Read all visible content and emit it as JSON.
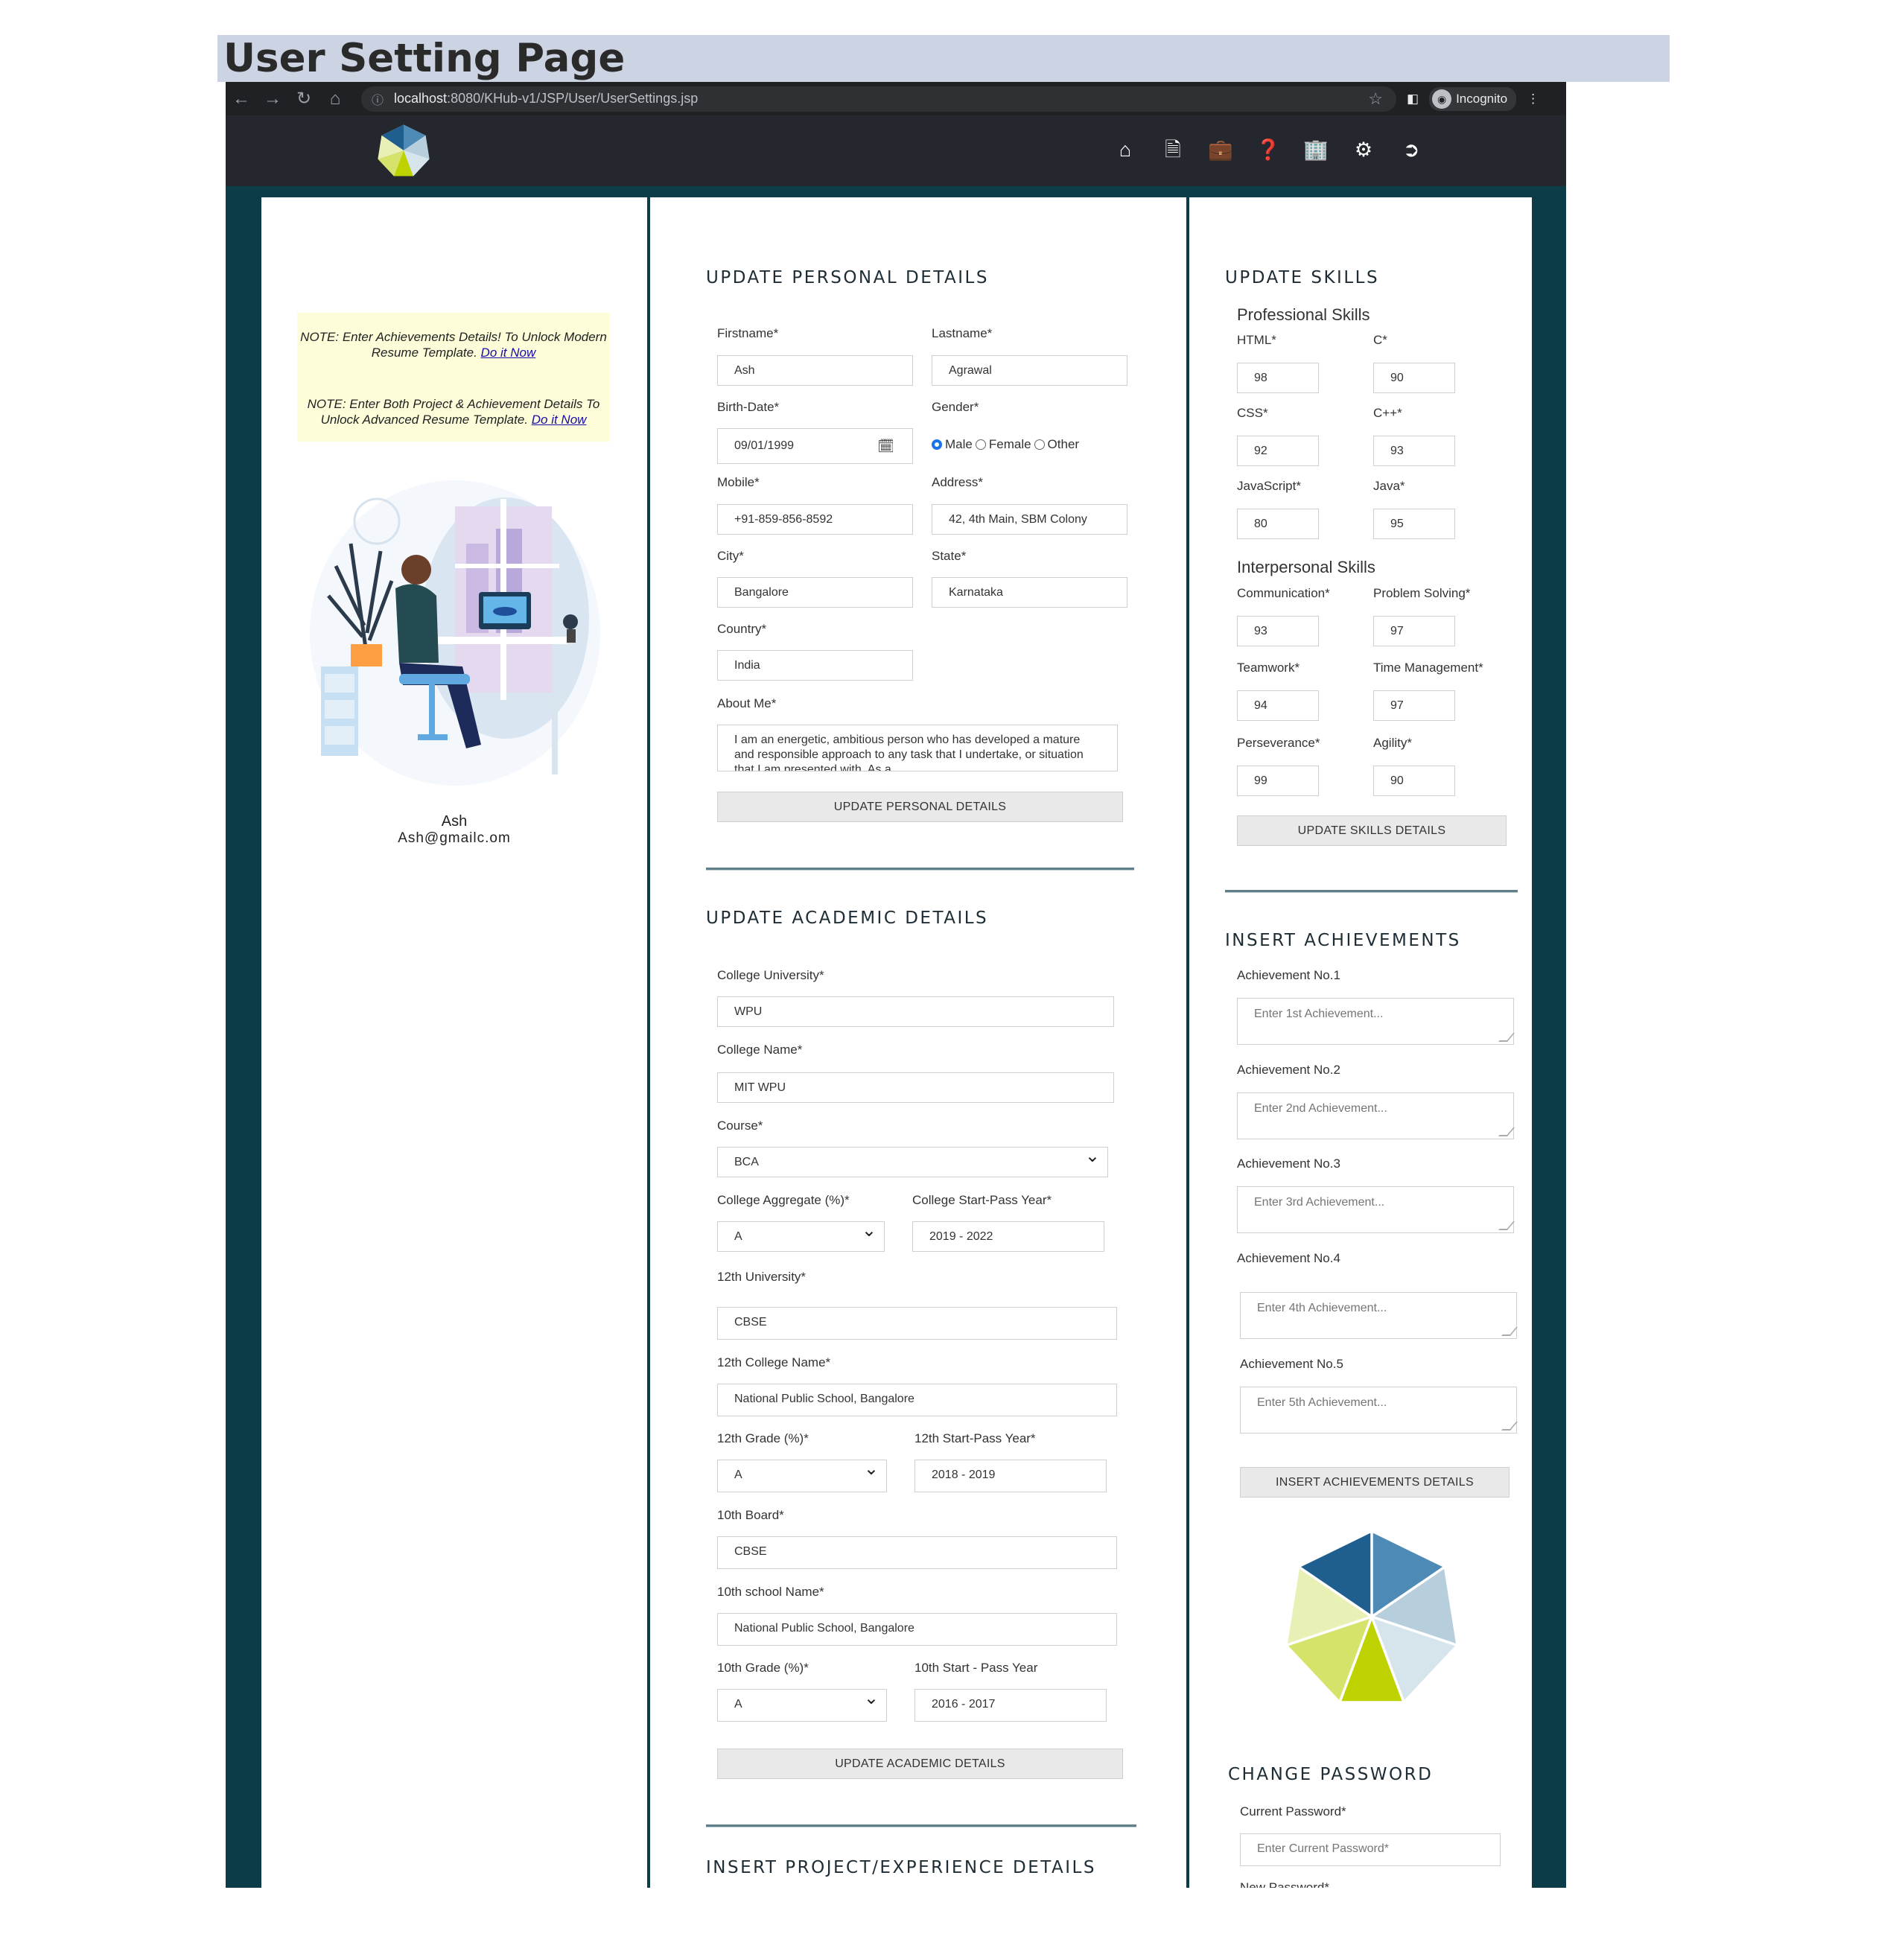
{
  "page_title": "User Setting Page",
  "browser": {
    "url_host": "localhost",
    "url_path": ":8080/KHub-v1/JSP/User/UserSettings.jsp",
    "incognito_label": "Incognito"
  },
  "sidebar": {
    "note1_text": "NOTE: Enter Achievements Details! To Unlock Modern Resume Template.",
    "note1_link": "Do it Now",
    "note2_text": "NOTE: Enter Both Project & Achievement Details To Unlock Advanced Resume Template.",
    "note2_link": "Do it Now",
    "user_name": "Ash",
    "user_email": "Ash@gmailc.om"
  },
  "personal": {
    "title": "UPDATE PERSONAL DETAILS",
    "firstname_label": "Firstname*",
    "firstname": "Ash",
    "lastname_label": "Lastname*",
    "lastname": "Agrawal",
    "birthdate_label": "Birth-Date*",
    "birthdate": "09/01/1999",
    "gender_label": "Gender*",
    "gender_options": [
      "Male",
      "Female",
      "Other"
    ],
    "mobile_label": "Mobile*",
    "mobile": "+91-859-856-8592",
    "address_label": "Address*",
    "address": "42, 4th Main, SBM Colony",
    "city_label": "City*",
    "city": "Bangalore",
    "state_label": "State*",
    "state": "Karnataka",
    "country_label": "Country*",
    "country": "India",
    "about_label": "About Me*",
    "about": "I am an energetic, ambitious person who has developed a mature and responsible approach to any task that I undertake, or situation that I am presented with. As a",
    "button": "UPDATE PERSONAL DETAILS"
  },
  "academic": {
    "title": "UPDATE ACADEMIC DETAILS",
    "college_university_label": "College University*",
    "college_university": "WPU",
    "college_name_label": "College Name*",
    "college_name": "MIT WPU",
    "course_label": "Course*",
    "course": "BCA",
    "college_aggregate_label": "College Aggregate (%)*",
    "college_aggregate": "A",
    "college_year_label": "College Start-Pass Year*",
    "college_year": "2019 - 2022",
    "twelfth_university_label": "12th University*",
    "twelfth_university": "CBSE",
    "twelfth_college_label": "12th College Name*",
    "twelfth_college": "National Public School, Bangalore",
    "twelfth_grade_label": "12th Grade (%)*",
    "twelfth_grade": "A",
    "twelfth_year_label": "12th Start-Pass Year*",
    "twelfth_year": "2018 - 2019",
    "tenth_board_label": "10th Board*",
    "tenth_board": "CBSE",
    "tenth_school_label": "10th school Name*",
    "tenth_school": "National Public School, Bangalore",
    "tenth_grade_label": "10th Grade (%)*",
    "tenth_grade": "A",
    "tenth_year_label": "10th Start - Pass Year",
    "tenth_year": "2016 - 2017",
    "button": "UPDATE ACADEMIC DETAILS"
  },
  "project": {
    "title": "INSERT PROJECT/EXPERIENCE DETAILS"
  },
  "skills": {
    "title": "UPDATE SKILLS",
    "professional_title": "Professional Skills",
    "html_label": "HTML*",
    "html": "98",
    "c_label": "C*",
    "c": "90",
    "css_label": "CSS*",
    "css": "92",
    "cpp_label": "C++*",
    "cpp": "93",
    "js_label": "JavaScript*",
    "js": "80",
    "java_label": "Java*",
    "java": "95",
    "interpersonal_title": "Interpersonal Skills",
    "communication_label": "Communication*",
    "communication": "93",
    "problem_label": "Problem Solving*",
    "problem": "97",
    "teamwork_label": "Teamwork*",
    "teamwork": "94",
    "time_label": "Time Management*",
    "time": "97",
    "perseverance_label": "Perseverance*",
    "perseverance": "99",
    "agility_label": "Agility*",
    "agility": "90",
    "button": "UPDATE SKILLS DETAILS"
  },
  "achievements": {
    "title": "INSERT ACHIEVEMENTS",
    "items": [
      {
        "label": "Achievement No.1",
        "placeholder": "Enter 1st Achievement..."
      },
      {
        "label": "Achievement No.2",
        "placeholder": "Enter 2nd Achievement..."
      },
      {
        "label": "Achievement No.3",
        "placeholder": "Enter 3rd Achievement..."
      },
      {
        "label": "Achievement No.4",
        "placeholder": "Enter 4th Achievement..."
      },
      {
        "label": "Achievement No.5",
        "placeholder": "Enter 5th Achievement..."
      }
    ],
    "button": "INSERT ACHIEVEMENTS DETAILS"
  },
  "password": {
    "title": "CHANGE PASSWORD",
    "current_label": "Current Password*",
    "current_placeholder": "Enter Current Password*",
    "new_label": "New Password*"
  },
  "colors": {
    "accent_blue": "#1a5a8a",
    "accent_lime": "#bcd100",
    "page_background": "#0c3c47",
    "title_band": "#ccd3e3"
  }
}
